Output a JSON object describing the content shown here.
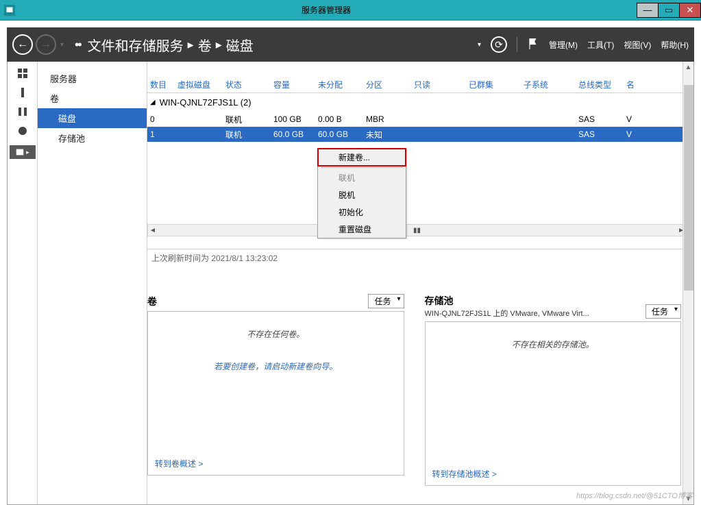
{
  "window": {
    "title": "服务器管理器"
  },
  "breadcrumb": {
    "leading": "••",
    "p1": "文件和存储服务",
    "p2": "卷",
    "p3": "磁盘",
    "sep": "▸"
  },
  "menubar": {
    "manage": "管理(M)",
    "tools": "工具(T)",
    "view": "视图(V)",
    "help": "帮助(H)"
  },
  "sidebar": {
    "items": [
      {
        "label": "服务器"
      },
      {
        "label": "卷"
      },
      {
        "label": "磁盘",
        "selected": true,
        "indent": true
      },
      {
        "label": "存储池",
        "indent": true
      }
    ]
  },
  "table": {
    "headers": {
      "num": "数目",
      "vd": "虚拟磁盘",
      "status": "状态",
      "cap": "容量",
      "unalloc": "未分配",
      "part": "分区",
      "ro": "只读",
      "clust": "已群集",
      "sub": "子系统",
      "bus": "总线类型",
      "name": "名"
    },
    "group": "WIN-QJNL72FJS1L (2)",
    "rows": [
      {
        "num": "0",
        "vd": "",
        "status": "联机",
        "cap": "100 GB",
        "unalloc": "0.00 B",
        "part": "MBR",
        "ro": "",
        "clust": "",
        "sub": "",
        "bus": "SAS",
        "name": "V"
      },
      {
        "num": "1",
        "vd": "",
        "status": "联机",
        "cap": "60.0 GB",
        "unalloc": "60.0 GB",
        "part": "未知",
        "ro": "",
        "clust": "",
        "sub": "",
        "bus": "SAS",
        "name": "V"
      }
    ],
    "last_refresh": "上次刷新时间为 2021/8/1 13:23:02"
  },
  "context_menu": {
    "items": [
      {
        "label": "新建卷...",
        "highlight": true
      },
      {
        "label": "联机",
        "disabled": true
      },
      {
        "label": "脱机"
      },
      {
        "label": "初始化"
      },
      {
        "label": "重置磁盘"
      }
    ]
  },
  "panels": {
    "volumes": {
      "title": "卷",
      "tasks": "任务",
      "msg": "不存在任何卷。",
      "hint": "若要创建卷，请启动新建卷向导。",
      "link": "转到卷概述 >"
    },
    "pools": {
      "title": "存储池",
      "subtitle": "WIN-QJNL72FJS1L 上的 VMware, VMware Virt...",
      "tasks": "任务",
      "msg": "不存在相关的存储池。",
      "link": "转到存储池概述 >"
    }
  },
  "watermark": "https://blog.csdn.net/@51CTO博客"
}
